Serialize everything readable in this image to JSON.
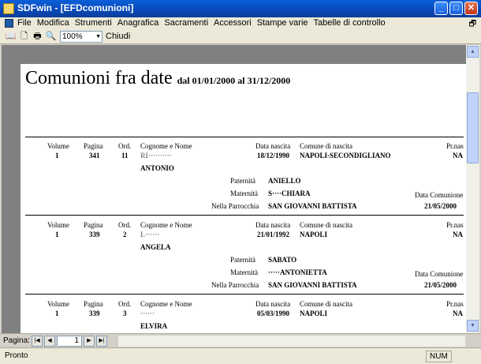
{
  "window": {
    "title": "SDFwin - [EFDcomunioni]",
    "btn_minimize": "_",
    "btn_maximize": "□",
    "btn_close": "✕",
    "doc_restore": "🗗"
  },
  "menu": [
    "File",
    "Modifica",
    "Strumenti",
    "Anagrafica",
    "Sacramenti",
    "Accessori",
    "Stampe varie",
    "Tabelle di controllo"
  ],
  "toolbar": {
    "zoom": "100%",
    "zoom_arrow": "▼",
    "close_label": "Chiudi",
    "icons": {
      "book": "📖",
      "preview": "🗋",
      "print": "🖶",
      "magnifier": "🔍"
    }
  },
  "report": {
    "title": "Comunioni fra date",
    "subtitle": "dal 01/01/2000 al 31/12/2000",
    "column_labels": {
      "volume": "Volume",
      "pagina": "Pagina",
      "ord": "Ord.",
      "nome": "Cognome e Nome",
      "data_nascita": "Data nascita",
      "comune": "Comune di nascita",
      "prov": "Pr.nas",
      "paternita": "Paternità",
      "maternita": "Maternità",
      "parrocchia": "Nella Parrocchia",
      "data_comunione": "Data Comunione"
    },
    "records": [
      {
        "volume": "1",
        "pagina": "341",
        "ord": "11",
        "cognome": "RI··········",
        "nome": "ANTONIO",
        "data_nascita": "18/12/1990",
        "comune": "NAPOLI-SECONDIGLIANO",
        "prov": "NA",
        "paternita": "ANIELLO",
        "maternita": "S····CHIARA",
        "parrocchia": "SAN GIOVANNI BATTISTA",
        "data_comunione": "21/05/2000"
      },
      {
        "volume": "1",
        "pagina": "339",
        "ord": "2",
        "cognome": "L······",
        "nome": "ANGELA",
        "data_nascita": "21/01/1992",
        "comune": "NAPOLI",
        "prov": "NA",
        "paternita": "SABATO",
        "maternita": "·····ANTONIETTA",
        "parrocchia": "SAN GIOVANNI BATTISTA",
        "data_comunione": "21/05/2000"
      },
      {
        "volume": "1",
        "pagina": "339",
        "ord": "3",
        "cognome": "······",
        "nome": "ELVIRA",
        "data_nascita": "05/03/1990",
        "comune": "NAPOLI",
        "prov": "NA"
      }
    ]
  },
  "nav": {
    "label": "Pagina:",
    "page": "1",
    "first": "|◀",
    "prev": "◀",
    "next": "▶",
    "last": "▶|",
    "new": "▶*"
  },
  "scroll": {
    "up": "▲",
    "down": "▼"
  },
  "status": {
    "text": "Pronto",
    "num": "NUM"
  }
}
